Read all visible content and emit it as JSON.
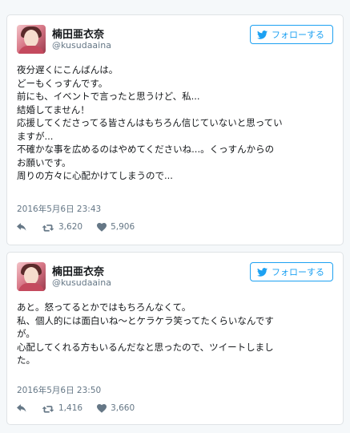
{
  "tweets": [
    {
      "display_name": "楠田亜衣奈",
      "screen_name": "@kusudaaina",
      "follow_label": "フォローする",
      "text_lines": [
        "夜分遅くにこんばんは。",
        "どーもくっすんです。",
        "前にも、イベントで言ったと思うけど、私...",
        "結婚してません！",
        "応援してくださってる皆さんはもちろん信じていないと思ってい",
        "ますが...",
        "不確かな事を広めるのはやめてくださいね...。くっすんからの",
        "お願いです。",
        "周りの方々に心配かけてしまうので..."
      ],
      "timestamp": "2016年5月6日 23:43",
      "retweets": "3,620",
      "likes": "5,906"
    },
    {
      "display_name": "楠田亜衣奈",
      "screen_name": "@kusudaaina",
      "follow_label": "フォローする",
      "text_lines": [
        "あと。怒ってるとかではもちろんなくて。",
        "私、個人的には面白いね〜とケラケラ笑ってたくらいなんです",
        "が。",
        "心配してくれる方もいるんだなと思ったので、ツイートしまし",
        "た。"
      ],
      "timestamp": "2016年5月6日 23:50",
      "retweets": "1,416",
      "likes": "3,660"
    }
  ],
  "icons": {
    "follow": "twitter-bird-icon",
    "reply": "reply-icon",
    "retweet": "retweet-icon",
    "like": "heart-icon"
  },
  "colors": {
    "accent": "#1da1f2",
    "muted": "#657786",
    "text": "#14171a",
    "border": "#dfe3e6"
  }
}
